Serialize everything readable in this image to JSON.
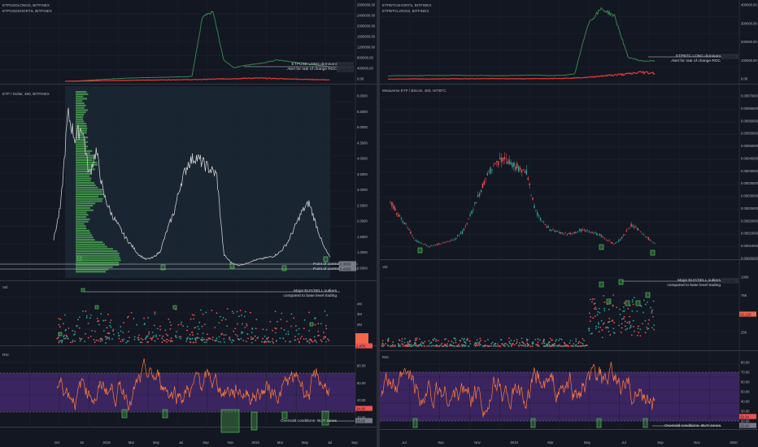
{
  "colors": {
    "background": "#131722",
    "grid": "#1e2230",
    "up": "#26a69a",
    "down": "#ef5350",
    "long_line": "#3b8f4f",
    "short_line": "#e53935",
    "rsi_line": "#ff7a3a",
    "rsi_band": "#3b2560",
    "volume_profile": "#4caf50",
    "price_line": "#c9c9c9",
    "marker_box": "#4caf50"
  },
  "chart_data": [
    {
      "type": "line",
      "pane": "left-top",
      "legend": [
        "ETPUSDLONGS, BITFINEX",
        "ETPUSDSHORTS, BITFINEX"
      ],
      "y_ticks": [
        "2800000.00",
        "2400000.00",
        "2000000.00",
        "1600000.00",
        "1200000.00",
        "800000.00",
        "400000.00",
        "0.00"
      ],
      "ylim": [
        0,
        2800000
      ],
      "series": [
        {
          "name": "ETPUSDLONGS, BITFINEX",
          "values": [
            0,
            10000,
            30000,
            60000,
            80000,
            100000,
            120000,
            130000,
            140000,
            150000,
            160000,
            170000,
            180000,
            2400000,
            2600000,
            800000,
            500000,
            600000,
            650000,
            700000,
            800000,
            750000,
            700000,
            650000,
            600000,
            550000
          ]
        },
        {
          "name": "ETPUSDSHORTS, BITFINEX",
          "values": [
            0,
            5000,
            10000,
            20000,
            25000,
            30000,
            35000,
            40000,
            45000,
            50000,
            55000,
            60000,
            60000,
            70000,
            80000,
            90000,
            100000,
            110000,
            120000,
            110000,
            100000,
            90000,
            80000,
            70000,
            60000,
            50000
          ]
        }
      ],
      "annotations": [
        "ETPUSD LONG dominant",
        "Alert for  rate of change ROC"
      ],
      "price_tags": [
        "4000000.00",
        "300000.00"
      ]
    },
    {
      "type": "line",
      "pane": "left-price",
      "title": "ETP / Dollar, 480, BITFINEX",
      "y_ticks": [
        "6.0000",
        "5.5000",
        "5.0000",
        "4.5000",
        "4.0000",
        "3.5000",
        "3.0000",
        "2.5000",
        "2.0000",
        "1.5000",
        "1.0000",
        "0.5000"
      ],
      "ylim": [
        0,
        6
      ],
      "x_ticks": [
        "Oct",
        "16",
        "2018",
        "Mar",
        "May",
        "Jul",
        "Sep",
        "Nov",
        "2019",
        "Mar",
        "May",
        "Jul",
        "Sep"
      ],
      "values": [
        1.1,
        2.2,
        5.2,
        4.4,
        4.8,
        3.2,
        4.0,
        2.6,
        2.0,
        1.6,
        1.2,
        0.9,
        0.6,
        0.45,
        0.5,
        0.7,
        1.4,
        2.0,
        3.0,
        3.6,
        3.8,
        3.6,
        3.4,
        3.2,
        0.6,
        0.35,
        0.25,
        0.3,
        0.4,
        0.45,
        0.5,
        0.55,
        0.7,
        1.0,
        1.5,
        2.0,
        2.3,
        1.6,
        0.9,
        0.5
      ],
      "annotations": [
        "Point of control",
        "Point of control"
      ],
      "price_tags": [
        "0.3550",
        "0.4300"
      ]
    },
    {
      "type": "scatter",
      "pane": "left-volume",
      "legend": [
        "Vol"
      ],
      "y_ticks": [
        "4M",
        "3M",
        "2M",
        "1M"
      ],
      "annotations": [
        "Major BUY/SELL outliers",
        "compared to base level trading"
      ],
      "price_tags": [
        "1.47K"
      ]
    },
    {
      "type": "line",
      "pane": "left-rsi",
      "legend": [
        "RSI"
      ],
      "y_ticks": [
        "80.00",
        "60.00",
        "40.00",
        "20.00"
      ],
      "ylim": [
        10,
        90
      ],
      "annotations": [
        "Oversold conditions- BUY zones"
      ],
      "price_tags": [
        "34.00",
        "20.00"
      ]
    },
    {
      "type": "line",
      "pane": "right-top",
      "legend": [
        "ETPBTCSHORTS, BITFINEX",
        "ETPBTCLONGS, BITFINEX"
      ],
      "y_ticks": [
        "400000.00",
        "300000.00",
        "200000.00",
        "100000.00",
        "0.00"
      ],
      "ylim": [
        0,
        400000
      ],
      "series": [
        {
          "name": "ETPBTCLONGS, BITFINEX",
          "values": [
            20000,
            22000,
            21000,
            23000,
            22000,
            24000,
            22000,
            23000,
            21000,
            22000,
            24000,
            25000,
            22000,
            23000,
            30000,
            300000,
            380000,
            340000,
            120000,
            100000,
            100000
          ]
        },
        {
          "name": "ETPBTCSHORTS, BITFINEX",
          "values": [
            3000,
            3500,
            4000,
            3500,
            4000,
            5000,
            4500,
            5000,
            5500,
            5000,
            4800,
            5200,
            6000,
            7000,
            9000,
            12000,
            20000,
            25000,
            30000,
            40000,
            35000
          ]
        }
      ],
      "annotations": [
        "ETPBTC LONG dominant",
        "Alert for  rate of change ROC"
      ],
      "price_tags": [
        "1924000.00"
      ]
    },
    {
      "type": "line",
      "pane": "right-price",
      "title": "Metaverse ETP / Bitcoin, 480, HITBTC",
      "y_ticks": [
        "0.0007000000",
        "0.0006500000",
        "0.0006000000",
        "0.0005500000",
        "0.0005000000",
        "0.0004500000",
        "0.0004000000",
        "0.0003500000",
        "0.0003000000",
        "0.0002500000",
        "0.0002000000",
        "0.0001500000",
        "0.0001000000",
        "0.0000500000"
      ],
      "ylim": [
        4e-05,
        0.00072
      ],
      "x_ticks": [
        "Jul",
        "Sep",
        "Nov",
        "2019",
        "Mar",
        "May",
        "Jul",
        "Sep",
        "Nov",
        "2020"
      ],
      "values": [
        0.00028,
        0.00022,
        0.00018,
        0.00012,
        0.0001,
        9e-05,
        0.0001,
        0.00011,
        0.00012,
        0.00015,
        0.00022,
        0.0003,
        0.00038,
        0.00043,
        0.00046,
        0.00044,
        0.00042,
        0.0004,
        0.00025,
        0.00019,
        0.00016,
        0.00015,
        0.00014,
        0.00015,
        0.00016,
        0.00015,
        0.00014,
        0.00012,
        0.0001,
        0.00013,
        0.00018,
        0.00016,
        0.00013,
        0.0001
      ],
      "price_tags": []
    },
    {
      "type": "scatter",
      "pane": "right-volume",
      "legend": [
        "Vol"
      ],
      "y_ticks": [
        "100K",
        "75K",
        "50K",
        "25K"
      ],
      "annotations": [
        "Major BUY/SELL outliers",
        "compared to base level trading"
      ],
      "price_tags": [
        "103.69K",
        "62.12K"
      ]
    },
    {
      "type": "line",
      "pane": "right-rsi",
      "legend": [
        "RSI"
      ],
      "y_ticks": [
        "80.00",
        "70.00",
        "60.00",
        "50.00",
        "40.00",
        "30.00",
        "20.00"
      ],
      "ylim": [
        15,
        85
      ],
      "annotations": [
        "Oversold conditions- BUY zones"
      ],
      "price_tags": [
        "29.34",
        "20.00"
      ]
    }
  ]
}
